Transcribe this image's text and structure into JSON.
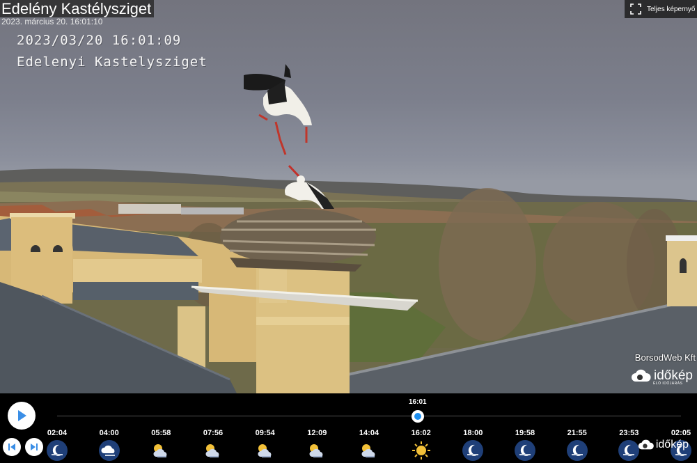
{
  "stream": {
    "title": "Edelény Kastélysziget",
    "capture_date": "2023. március 20. 16:01:10",
    "osd_timestamp": "2023/03/20 16:01:09",
    "osd_location": "Edelenyi Kastelysziget",
    "fullscreen_label": "Teljes képernyő",
    "credit": "BorsodWeb Kft",
    "logo_text": "időkép",
    "logo_tagline": "ÉLŐ IDŐJÁRÁS"
  },
  "player": {
    "current_time": "16:01",
    "progress_fraction": 0.578,
    "timeline": [
      {
        "time": "02:04",
        "icon": "moon-icon"
      },
      {
        "time": "04:00",
        "icon": "cloudy-night-icon"
      },
      {
        "time": "05:58",
        "icon": "partly-cloudy-icon"
      },
      {
        "time": "07:56",
        "icon": "partly-cloudy-icon"
      },
      {
        "time": "09:54",
        "icon": "partly-cloudy-icon"
      },
      {
        "time": "12:09",
        "icon": "partly-cloudy-icon"
      },
      {
        "time": "14:04",
        "icon": "partly-cloudy-icon"
      },
      {
        "time": "16:02",
        "icon": "sun-icon"
      },
      {
        "time": "18:00",
        "icon": "moon-icon"
      },
      {
        "time": "19:58",
        "icon": "moon-icon"
      },
      {
        "time": "21:55",
        "icon": "moon-icon"
      },
      {
        "time": "23:53",
        "icon": "moon-icon"
      },
      {
        "time": "02:05",
        "icon": "moon-icon"
      }
    ],
    "bar_logo_text": "időkép"
  },
  "colors": {
    "accent": "#1e8ff0",
    "play_icon": "#3a8ee6",
    "bar_background": "#000000",
    "night_badge": "#1f3f78"
  }
}
